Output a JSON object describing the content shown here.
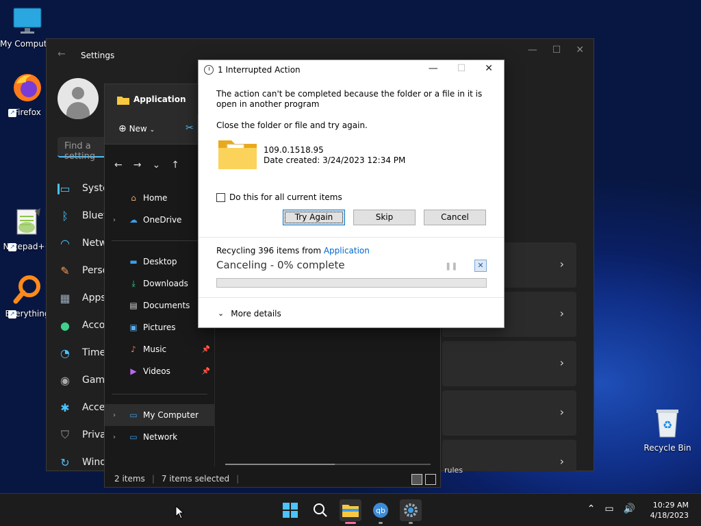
{
  "desktop": {
    "icons": [
      {
        "label": "My Computer"
      },
      {
        "label": "Firefox"
      },
      {
        "label": "Notepad++"
      },
      {
        "label": "Everything"
      },
      {
        "label": "Recycle Bin"
      }
    ]
  },
  "settings": {
    "title": "Settings",
    "search_placeholder": "Find a setting",
    "nav": [
      {
        "label": "System",
        "icon": "monitor-icon"
      },
      {
        "label": "Bluetooth & devices",
        "icon": "bluetooth-icon"
      },
      {
        "label": "Network & internet",
        "icon": "wifi-icon"
      },
      {
        "label": "Personalization",
        "icon": "brush-icon"
      },
      {
        "label": "Apps",
        "icon": "apps-icon"
      },
      {
        "label": "Accounts",
        "icon": "person-icon"
      },
      {
        "label": "Time & language",
        "icon": "clock-globe-icon"
      },
      {
        "label": "Gaming",
        "icon": "controller-icon"
      },
      {
        "label": "Accessibility",
        "icon": "accessibility-icon"
      },
      {
        "label": "Privacy & security",
        "icon": "shield-icon"
      },
      {
        "label": "Windows Update",
        "icon": "update-icon"
      }
    ],
    "partial_text": "rules"
  },
  "explorer": {
    "tab_title": "Application",
    "new_label": "New",
    "sidebar": [
      {
        "label": "Home",
        "icon": "home-icon"
      },
      {
        "label": "OneDrive",
        "icon": "cloud-icon"
      },
      {
        "label": "Desktop",
        "icon": "desktop-folder-icon"
      },
      {
        "label": "Downloads",
        "icon": "download-icon"
      },
      {
        "label": "Documents",
        "icon": "document-icon"
      },
      {
        "label": "Pictures",
        "icon": "picture-icon"
      },
      {
        "label": "Music",
        "icon": "music-icon"
      },
      {
        "label": "Videos",
        "icon": "video-icon"
      },
      {
        "label": "My Computer",
        "icon": "computer-icon"
      },
      {
        "label": "Network",
        "icon": "network-icon"
      }
    ],
    "status_items": "2 items",
    "status_selected": "7 items selected"
  },
  "dialog": {
    "title": "1 Interrupted Action",
    "message": "The action can't be completed because the folder or a file in it is open in another program",
    "instruction": "Close the folder or file and try again.",
    "file_name": "109.0.1518.95",
    "file_date": "Date created: 3/24/2023 12:34 PM",
    "checkbox_label": "Do this for all current items",
    "buttons": {
      "try_again": "Try Again",
      "skip": "Skip",
      "cancel": "Cancel"
    },
    "recycling_prefix": "Recycling 396 items from ",
    "recycling_source": "Application",
    "progress_label": "Canceling - 0% complete",
    "progress_percent": 0,
    "more_details": "More details"
  },
  "taskbar": {
    "time": "10:29 AM",
    "date": "4/18/2023"
  },
  "colors": {
    "accent": "#4cc2ff",
    "link": "#0066cc"
  }
}
